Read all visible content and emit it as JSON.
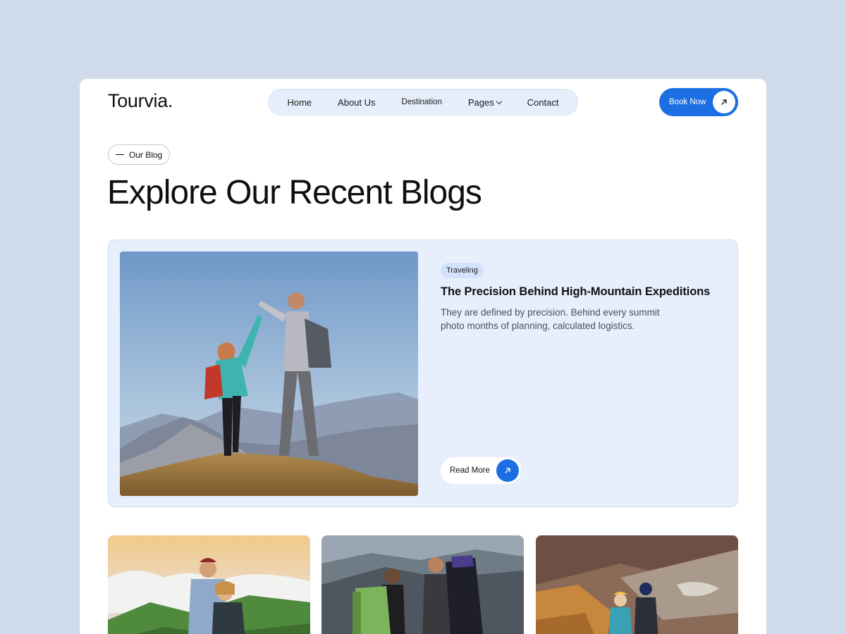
{
  "brand": {
    "logo": "Tourvia."
  },
  "nav": {
    "items": [
      {
        "label": "Home"
      },
      {
        "label": "About Us"
      },
      {
        "label": "Destination"
      },
      {
        "label": "Pages"
      },
      {
        "label": "Contact"
      }
    ]
  },
  "header": {
    "cta_label": "Book Now",
    "cta_icon": "arrow-up-right-icon"
  },
  "section": {
    "tag": "Our Blog",
    "title": "Explore Our Recent Blogs"
  },
  "featured_post": {
    "category": "Traveling",
    "title": "The Precision Behind High-Mountain Expeditions",
    "description": "They are defined by precision. Behind every summit photo months of planning, calculated logistics.",
    "read_more_label": "Read More",
    "image": "two-hikers-high-five-on-mountain-photo"
  },
  "more_posts": [
    {
      "image": "couple-hikers-above-clouds-photo"
    },
    {
      "image": "group-backpackers-mountain-photo"
    },
    {
      "image": "hikers-overlooking-valley-photo"
    }
  ],
  "colors": {
    "page_bg": "#cfdbea",
    "accent": "#1b6fe3",
    "nav_bg": "#e6eefb",
    "feature_bg": "#e7effd"
  }
}
